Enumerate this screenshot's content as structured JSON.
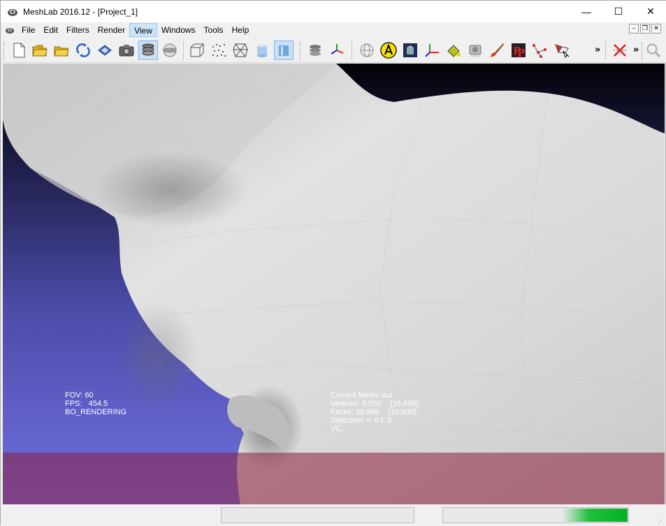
{
  "window": {
    "title": "MeshLab 2016.12 - [Project_1]",
    "minimize_glyph": "—",
    "maximize_glyph": "☐",
    "close_glyph": "✕"
  },
  "menu": {
    "items": [
      "File",
      "Edit",
      "Filters",
      "Render",
      "View",
      "Windows",
      "Tools",
      "Help"
    ],
    "active": "View"
  },
  "mdi": {
    "minimize": "–",
    "restore": "❐",
    "close": "✕"
  },
  "toolbar": {
    "more_glyph": "»",
    "icons": [
      "new-project-icon",
      "open-project-icon",
      "import-mesh-icon",
      "reload-icon",
      "save-snapshot-icon",
      "camera-icon",
      "layers-icon",
      "trackball-icon",
      "bounding-box-icon",
      "points-icon",
      "wireframe-icon",
      "flat-icon",
      "smooth-icon",
      "layer-dialog-icon",
      "sphere-icon",
      "annotation-a-icon",
      "raster-icon",
      "axis-icon",
      "paint-bucket-icon",
      "align-icon",
      "brush-icon",
      "pickpoints-icon",
      "select-vertices-icon",
      "select-faces-icon",
      "remove-selection-icon",
      "zoom-icon"
    ]
  },
  "viewport": {
    "background_top": "#030308",
    "background_bottom": "#7070e0",
    "mesh_color": "#dcdcdc",
    "overlay_color": "#8c1e3c"
  },
  "info": {
    "fov": "FOV: 60",
    "fps": "FPS:   454.5",
    "rendering": "BO_RENDERING",
    "current_mesh": "Current Mesh: out",
    "vertices": "Vertices: 5,550    (16,658)",
    "faces": "Faces: 10,996    (33,000)",
    "selection": "Selection: v: 0 f: 0",
    "vc": "VC"
  },
  "status": {
    "progress": 0.35
  }
}
